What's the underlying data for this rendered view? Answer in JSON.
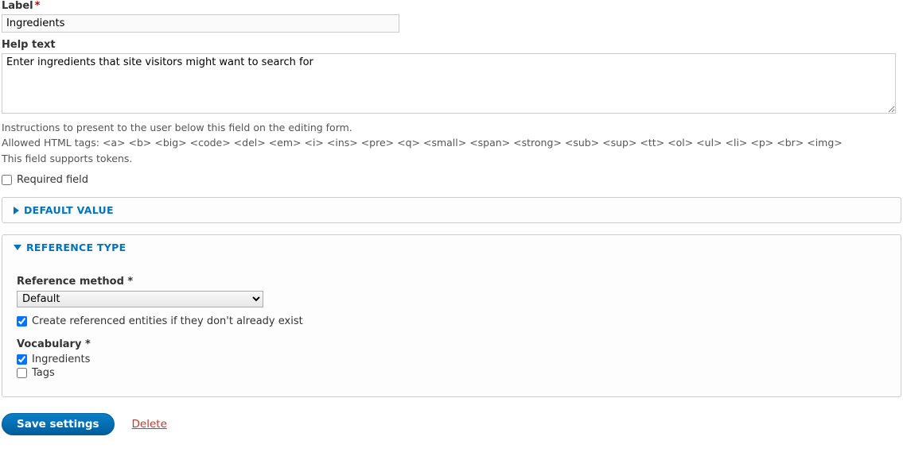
{
  "label_field": {
    "label": "Label",
    "value": "Ingredients"
  },
  "help_field": {
    "label": "Help text",
    "value": "Enter ingredients that site visitors might want to search for",
    "desc1": "Instructions to present to the user below this field on the editing form.",
    "desc2": "Allowed HTML tags: <a> <b> <big> <code> <del> <em> <i> <ins> <pre> <q> <small> <span> <strong> <sub> <sup> <tt> <ol> <ul> <li> <p> <br> <img>",
    "desc3": "This field supports tokens."
  },
  "required": {
    "label": "Required field",
    "checked": false
  },
  "fieldset_default": {
    "title": "DEFAULT VALUE"
  },
  "fieldset_ref": {
    "title": "REFERENCE TYPE",
    "method_label": "Reference method",
    "method_value": "Default",
    "create_label": "Create referenced entities if they don't already exist",
    "create_checked": true,
    "vocab_label": "Vocabulary",
    "vocab_options": [
      {
        "label": "Ingredients",
        "checked": true
      },
      {
        "label": "Tags",
        "checked": false
      }
    ]
  },
  "actions": {
    "save": "Save settings",
    "delete": "Delete"
  }
}
